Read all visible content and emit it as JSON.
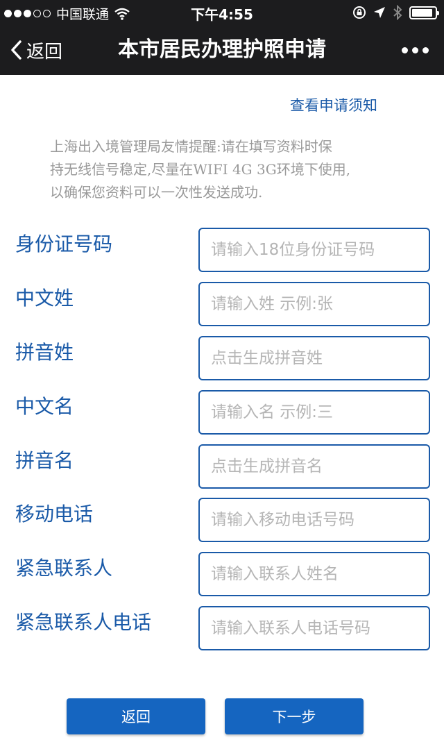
{
  "status_bar": {
    "carrier": "中国联通",
    "time": "下午4:55",
    "signal_full": 3,
    "signal_total": 5,
    "battery_level": 0.9
  },
  "nav": {
    "back_label": "返回",
    "title": "本市居民办理护照申请"
  },
  "notice_link": "查看申请须知",
  "tip": {
    "line1": "上海出入境管理局友情提醒:请在填写资料时保",
    "line2": "持无线信号稳定,尽量在WIFI 4G 3G环境下使用,",
    "line3": "以确保您资料可以一次性发送成功."
  },
  "fields": [
    {
      "label": "身份证号码",
      "placeholder": "请输入18位身份证号码",
      "value": ""
    },
    {
      "label": "中文姓",
      "placeholder": "请输入姓 示例:张",
      "value": ""
    },
    {
      "label": "拼音姓",
      "placeholder": "点击生成拼音姓",
      "value": ""
    },
    {
      "label": "中文名",
      "placeholder": "请输入名 示例:三",
      "value": ""
    },
    {
      "label": "拼音名",
      "placeholder": "点击生成拼音名",
      "value": ""
    },
    {
      "label": "移动电话",
      "placeholder": "请输入移动电话号码",
      "value": ""
    },
    {
      "label": "紧急联系人",
      "placeholder": "请输入联系人姓名",
      "value": ""
    },
    {
      "label": "紧急联系人电话",
      "placeholder": "请输入联系人电话号码",
      "value": ""
    }
  ],
  "buttons": {
    "back": "返回",
    "next": "下一步"
  },
  "colors": {
    "accent": "#1a5aa8",
    "button": "#1565c0",
    "bar": "#1c1c1e",
    "tip_text": "#9a9a9a",
    "placeholder": "#b5b5b5"
  }
}
